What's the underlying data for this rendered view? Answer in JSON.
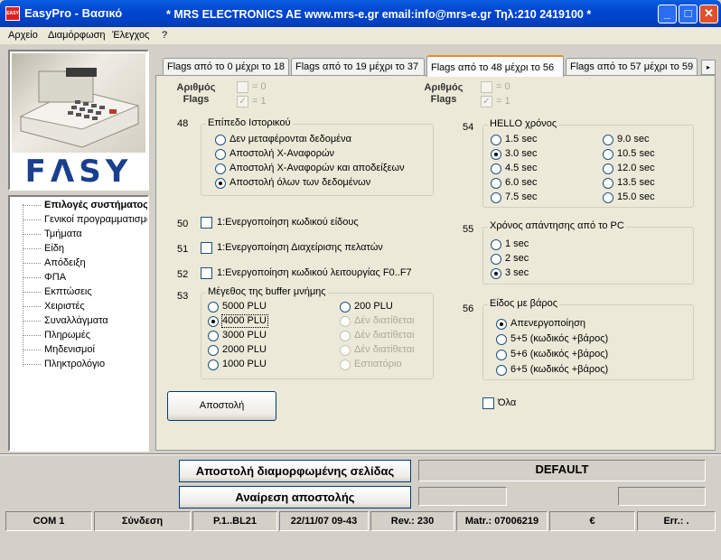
{
  "window": {
    "app_title": "EasyPro - Βασικό",
    "company_text": "*  MRS ELECTRONICS AE  www.mrs-e.gr   email:info@mrs-e.gr  Τηλ:210 2419100  *",
    "icon_text": "EASY"
  },
  "menu": [
    "Αρχείο",
    "Διαμόρφωση",
    "Έλεγχος",
    "?"
  ],
  "logo_text": "FΛSY",
  "tree": {
    "root": "Επιλογές συστήματος",
    "items": [
      "Γενικοί προγραμματισμοί",
      "Τμήματα",
      "Είδη",
      "Απόδειξη",
      "ΦΠΑ",
      "Εκπτώσεις",
      "Χειριστές",
      "Συναλλάγματα",
      "Πληρωμές",
      "Μηδενισμοί",
      "Πληκτρολόγιο"
    ]
  },
  "tabs": [
    {
      "label": "Flags από το 0 μέχρι το 18",
      "active": false
    },
    {
      "label": "Flags από το 19 μέχρι το 37",
      "active": false
    },
    {
      "label": "Flags από το 48 μέχρι το 56",
      "active": true
    },
    {
      "label": "Flags από το 57 μέχρι το 59",
      "active": false
    }
  ],
  "flag_header": {
    "label_line1": "Αριθμός",
    "label_line2": "Flags",
    "eq0": "= 0",
    "eq1": "= 1"
  },
  "flag48": {
    "number": "48",
    "title": "Επίπεδο Ιστορικού",
    "options": [
      "Δεν μεταφέρονται δεδομένα",
      "Αποστολή Χ-Αναφορών",
      "Αποστολή Χ-Αναφορών και αποδείξεων",
      "Αποστολή όλων των δεδομένων"
    ],
    "selected": 3
  },
  "flag50": {
    "number": "50",
    "label": "1:Ενεργοποίηση κωδικού είδους",
    "checked": false
  },
  "flag51": {
    "number": "51",
    "label": "1:Ενεργοποίηση Διαχείρισης πελατών",
    "checked": false
  },
  "flag52": {
    "number": "52",
    "label": "1:Ενεργοποίηση κωδικού λειτουργίας F0..F7",
    "checked": false
  },
  "flag53": {
    "number": "53",
    "title": "Μέγεθος της buffer μνήμης",
    "left_options": [
      "5000 PLU",
      "4000 PLU",
      "3000 PLU",
      "2000 PLU",
      "1000 PLU"
    ],
    "right_options": [
      "200 PLU",
      "Δέν διατίθεται",
      "Δέν διατίθεται",
      "Δέν διατίθεται",
      "Εστιατόριο"
    ],
    "selected": "4000 PLU"
  },
  "flag54": {
    "number": "54",
    "title": "HELLO χρόνος",
    "left_options": [
      "1.5 sec",
      "3.0 sec",
      "4.5 sec",
      "6.0 sec",
      "7.5 sec"
    ],
    "right_options": [
      "9.0 sec",
      "10.5 sec",
      "12.0 sec",
      "13.5 sec",
      "15.0 sec"
    ],
    "selected": "3.0 sec"
  },
  "flag55": {
    "number": "55",
    "title": "Χρόνος απάντησης από το PC",
    "options": [
      "1 sec",
      "2 sec",
      "3 sec"
    ],
    "selected": "3 sec"
  },
  "flag56": {
    "number": "56",
    "title": "Είδος με βάρος",
    "options": [
      "Απενεργοποίηση",
      "5+5 (κωδικός +βάρος)",
      "5+6 (κωδικός +βάρος)",
      "6+5 (κωδικός +βάρος)"
    ],
    "selected": 0
  },
  "send_button": "Αποστολή",
  "all_checkbox": {
    "label": "Όλα",
    "checked": false
  },
  "bottom": {
    "send_page_button": "Αποστολή διαμορφωμένης σελίδας",
    "cancel_send_button": "Αναίρεση αποστολής",
    "default_label": "DEFAULT"
  },
  "statusbar": [
    "COM  1",
    "Σύνδεση",
    "P.1..BL21",
    "22/11/07 09-43",
    "Rev.: 230",
    "Matr.: 07006219",
    "€",
    "Err.: ."
  ]
}
